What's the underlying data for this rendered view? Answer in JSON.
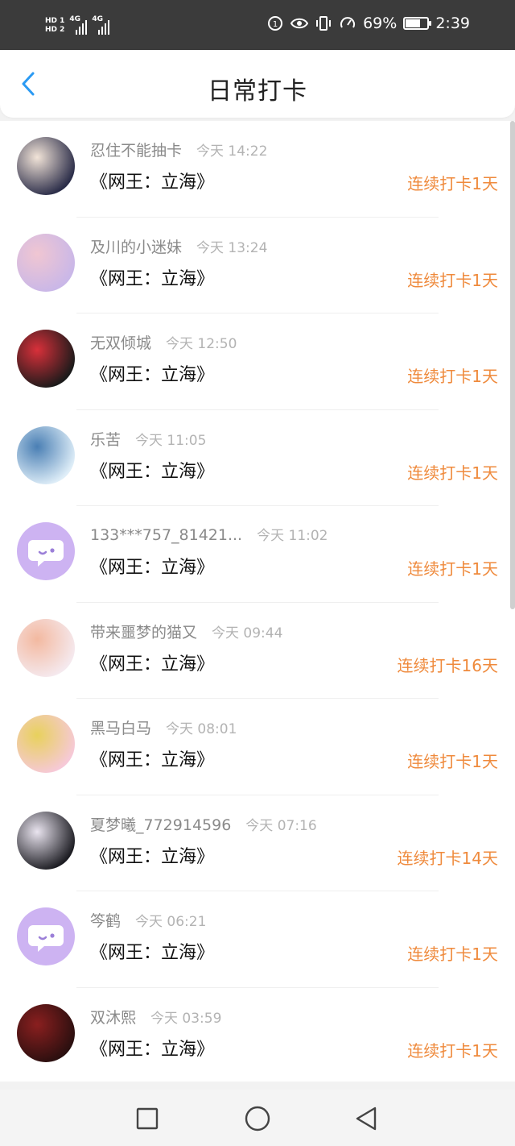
{
  "status_bar": {
    "hd1": "HD 1",
    "hd2": "HD 2",
    "net1": "4G",
    "net2": "4G",
    "battery_text": "69%",
    "battery_level": 0.69,
    "time": "2:39"
  },
  "header": {
    "title": "日常打卡",
    "back_icon": "chevron-left-icon"
  },
  "checkins": [
    {
      "name": "忍住不能抽卡",
      "time": "今天 14:22",
      "book": "《网王：立海》",
      "streak": "连续打卡1天",
      "avatar_colors": [
        "#2a2c48",
        "#f2e4d8"
      ]
    },
    {
      "name": "及川的小迷妹",
      "time": "今天 13:24",
      "book": "《网王：立海》",
      "streak": "连续打卡1天",
      "avatar_colors": [
        "#c9b7e8",
        "#f0c6d2"
      ]
    },
    {
      "name": "无双倾城",
      "time": "今天 12:50",
      "book": "《网王：立海》",
      "streak": "连续打卡1天",
      "avatar_colors": [
        "#1a1a1a",
        "#d8303a"
      ]
    },
    {
      "name": "乐苦",
      "time": "今天 11:05",
      "book": "《网王：立海》",
      "streak": "连续打卡1天",
      "avatar_colors": [
        "#dfeef8",
        "#4a7fb4"
      ]
    },
    {
      "name": "133***757_81421...",
      "time": "今天 11:02",
      "book": "《网王：立海》",
      "streak": "连续打卡1天",
      "avatar_colors": [
        "#cdb3f2",
        "#ffffff"
      ]
    },
    {
      "name": "带来噩梦的猫又",
      "time": "今天 09:44",
      "book": "《网王：立海》",
      "streak": "连续打卡16天",
      "avatar_colors": [
        "#f5e9ee",
        "#f3b9a0"
      ]
    },
    {
      "name": "黑马白马",
      "time": "今天 08:01",
      "book": "《网王：立海》",
      "streak": "连续打卡1天",
      "avatar_colors": [
        "#f6c9d8",
        "#e8d15c"
      ]
    },
    {
      "name": "夏梦曦_772914596",
      "time": "今天 07:16",
      "book": "《网王：立海》",
      "streak": "连续打卡14天",
      "avatar_colors": [
        "#1c1c22",
        "#e9e4ef"
      ]
    },
    {
      "name": "笒鹤",
      "time": "今天 06:21",
      "book": "《网王：立海》",
      "streak": "连续打卡1天",
      "avatar_colors": [
        "#cdb3f2",
        "#ffffff"
      ]
    },
    {
      "name": "双沐熙",
      "time": "今天 03:59",
      "book": "《网王：立海》",
      "streak": "连续打卡1天",
      "avatar_colors": [
        "#2a0f0f",
        "#8a1f1f"
      ]
    }
  ],
  "colors": {
    "accent": "#2b9af3",
    "streak": "#ef8a3c",
    "placeholder_avatar": "#cdb3f2"
  },
  "nav_bar": {
    "recent_icon": "square-icon",
    "home_icon": "circle-icon",
    "back_icon": "triangle-back-icon"
  }
}
